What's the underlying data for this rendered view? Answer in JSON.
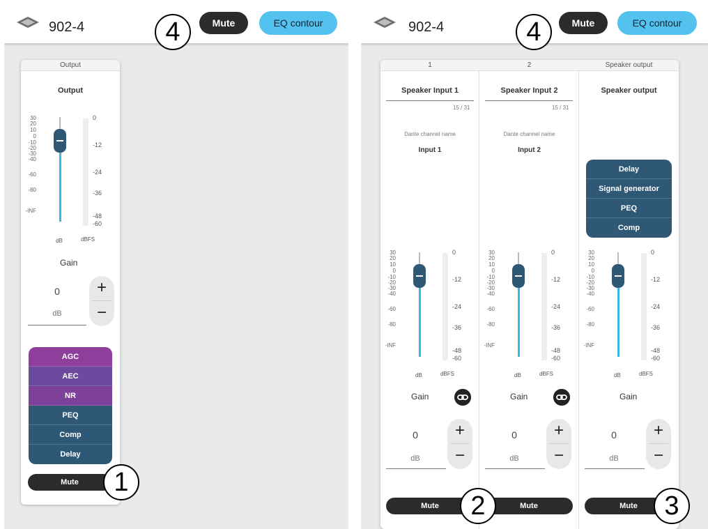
{
  "left": {
    "device_title": "902-4",
    "mute_label": "Mute",
    "eq_label": "EQ contour",
    "channel": {
      "header": "Output",
      "name": "Output",
      "fader_scale": [
        "30",
        "20",
        "10",
        "0",
        "-10",
        "-20",
        "-30",
        "-40",
        "-60",
        "-80",
        "-INF"
      ],
      "meter_scale": [
        "0",
        "-12",
        "-24",
        "-36",
        "-48",
        "-60"
      ],
      "fader_unit": "dB",
      "meter_unit": "dBFS",
      "gain_label": "Gain",
      "gain_value": "0",
      "gain_unit": "dB",
      "plus": "+",
      "minus": "−",
      "blocks": [
        "AGC",
        "AEC",
        "NR",
        "PEQ",
        "Comp",
        "Delay"
      ],
      "mute": "Mute"
    }
  },
  "right": {
    "device_title": "902-4",
    "mute_label": "Mute",
    "eq_label": "EQ contour",
    "columns": [
      {
        "header": "1",
        "name": "Speaker Input 1",
        "char_count": "15 / 31",
        "dante_label": "Dante channel name",
        "dante_name": "Input 1",
        "gain_label": "Gain",
        "gain_value": "0",
        "gain_unit": "dB",
        "plus": "+",
        "minus": "−",
        "mute": "Mute"
      },
      {
        "header": "2",
        "name": "Speaker Input 2",
        "char_count": "15 / 31",
        "dante_label": "Dante channel name",
        "dante_name": "Input 2",
        "gain_label": "Gain",
        "gain_value": "0",
        "gain_unit": "dB",
        "plus": "+",
        "minus": "−",
        "mute": "Mute"
      },
      {
        "header": "Speaker output",
        "name": "Speaker output",
        "blocks": [
          "Delay",
          "Signal generator",
          "PEQ",
          "Comp"
        ],
        "gain_label": "Gain",
        "gain_value": "0",
        "gain_unit": "dB",
        "plus": "+",
        "minus": "−",
        "mute": "Mute"
      }
    ],
    "fader_scale": [
      "30",
      "20",
      "10",
      "0",
      "-10",
      "-20",
      "-30",
      "-40",
      "-60",
      "-80",
      "-INF"
    ],
    "meter_scale": [
      "0",
      "-12",
      "-24",
      "-36",
      "-48",
      "-60"
    ],
    "fader_unit": "dB",
    "meter_unit": "dBFS"
  },
  "callouts": [
    "1",
    "2",
    "3",
    "4",
    "4"
  ],
  "colors": {
    "accent_blue": "#54c2ee",
    "fader_fill": "#39b6ea",
    "block_purple": "#8e3f9c",
    "block_violet": "#6c4a9e",
    "block_teal": "#2f5876",
    "dark": "#2b2b2b"
  }
}
